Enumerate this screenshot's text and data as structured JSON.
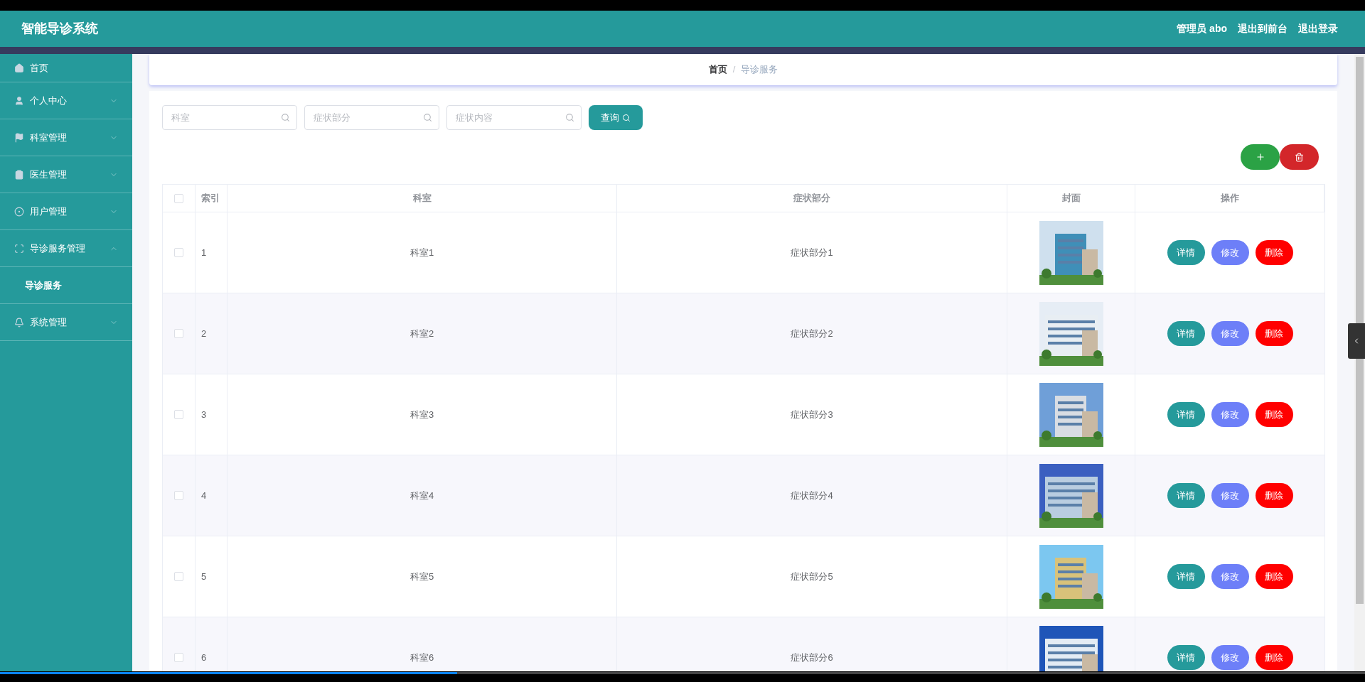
{
  "header": {
    "title": "智能导诊系统",
    "links": [
      "管理员 abo",
      "退出到前台",
      "退出登录"
    ]
  },
  "sidebar": {
    "items": [
      {
        "label": "首页"
      },
      {
        "label": "个人中心",
        "expanded": false
      },
      {
        "label": "科室管理",
        "expanded": false
      },
      {
        "label": "医生管理",
        "expanded": false
      },
      {
        "label": "用户管理",
        "expanded": false
      },
      {
        "label": "导诊服务管理",
        "expanded": true,
        "children": [
          {
            "label": "导诊服务",
            "selected": true
          }
        ]
      },
      {
        "label": "系统管理",
        "expanded": false
      }
    ]
  },
  "breadcrumb": {
    "items": [
      "首页",
      "导诊服务"
    ],
    "separator": "/"
  },
  "search": {
    "fields": [
      {
        "placeholder": "科室"
      },
      {
        "placeholder": "症状部分"
      },
      {
        "placeholder": "症状内容"
      }
    ],
    "button": "查询"
  },
  "table": {
    "all_checked": false,
    "columns": [
      "索引",
      "科室",
      "症状部分",
      "封面",
      "操作"
    ],
    "rows": [
      {
        "checked": false,
        "index": "1",
        "department": "科室1",
        "symptom": "症状部分1",
        "actions": [
          {
            "label": "详情",
            "kind": "detail"
          },
          {
            "label": "修改",
            "kind": "edit"
          },
          {
            "label": "删除",
            "kind": "delete"
          }
        ]
      },
      {
        "checked": false,
        "index": "2",
        "department": "科室2",
        "symptom": "症状部分2",
        "actions": [
          {
            "label": "详情",
            "kind": "detail"
          },
          {
            "label": "修改",
            "kind": "edit"
          },
          {
            "label": "删除",
            "kind": "delete"
          }
        ]
      },
      {
        "checked": false,
        "index": "3",
        "department": "科室3",
        "symptom": "症状部分3",
        "actions": [
          {
            "label": "详情",
            "kind": "detail"
          },
          {
            "label": "修改",
            "kind": "edit"
          },
          {
            "label": "删除",
            "kind": "delete"
          }
        ]
      },
      {
        "checked": false,
        "index": "4",
        "department": "科室4",
        "symptom": "症状部分4",
        "actions": [
          {
            "label": "详情",
            "kind": "detail"
          },
          {
            "label": "修改",
            "kind": "edit"
          },
          {
            "label": "删除",
            "kind": "delete"
          }
        ]
      },
      {
        "checked": false,
        "index": "5",
        "department": "科室5",
        "symptom": "症状部分5",
        "actions": [
          {
            "label": "详情",
            "kind": "detail"
          },
          {
            "label": "修改",
            "kind": "edit"
          },
          {
            "label": "删除",
            "kind": "delete"
          }
        ]
      },
      {
        "checked": false,
        "index": "6",
        "department": "科室6",
        "symptom": "症状部分6",
        "actions": [
          {
            "label": "详情",
            "kind": "detail"
          },
          {
            "label": "修改",
            "kind": "edit"
          },
          {
            "label": "删除",
            "kind": "delete"
          }
        ]
      }
    ]
  },
  "player": {
    "level": 0.335
  }
}
